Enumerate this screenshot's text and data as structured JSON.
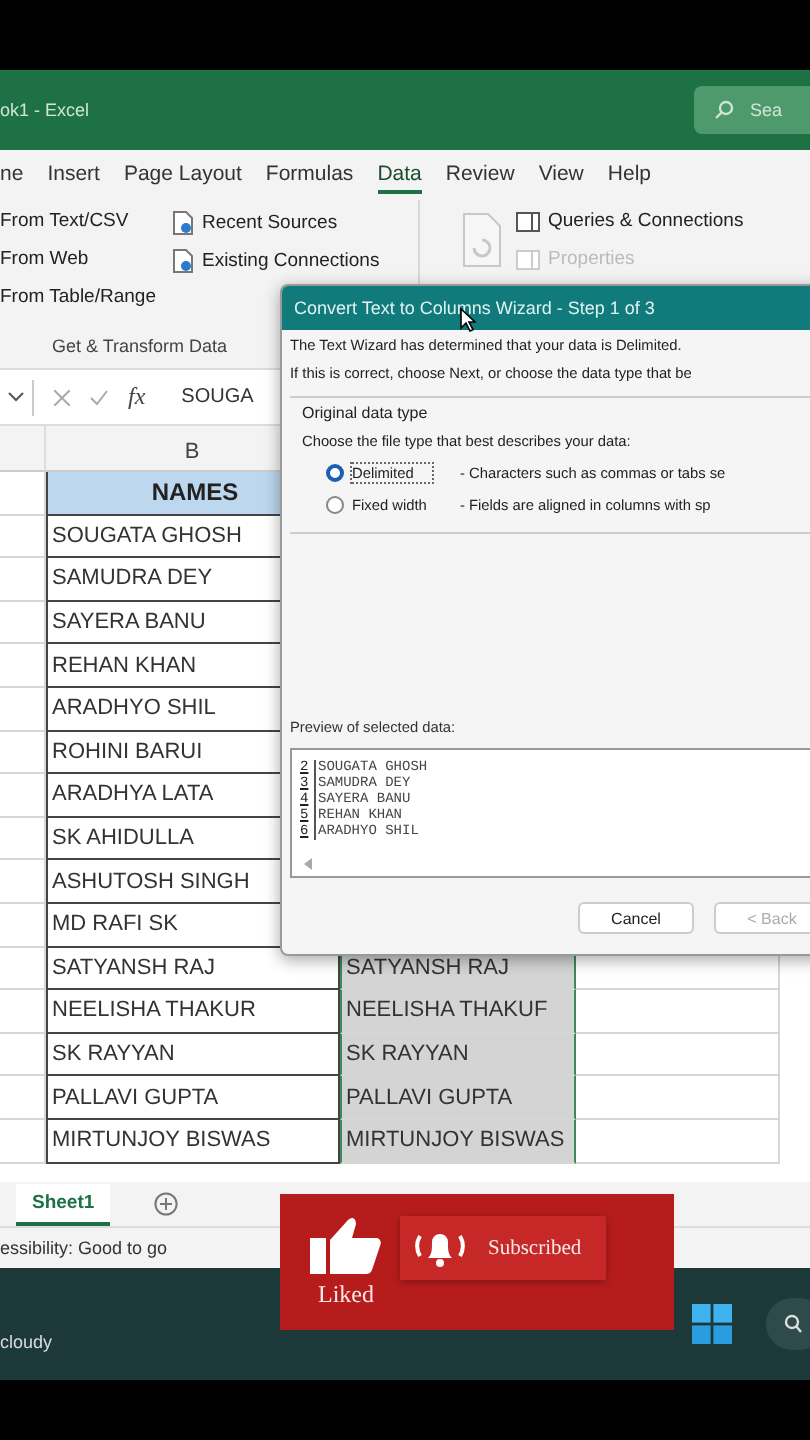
{
  "window": {
    "title": "ok1 - Excel",
    "search_placeholder": "Sea"
  },
  "ribbon_tabs": [
    {
      "label": "ne",
      "selected": false
    },
    {
      "label": "Insert",
      "selected": false
    },
    {
      "label": "Page Layout",
      "selected": false
    },
    {
      "label": "Formulas",
      "selected": false
    },
    {
      "label": "Data",
      "selected": true
    },
    {
      "label": "Review",
      "selected": false
    },
    {
      "label": "View",
      "selected": false
    },
    {
      "label": "Help",
      "selected": false
    }
  ],
  "ribbon": {
    "get_data": [
      "From Text/CSV",
      "From Web",
      "From Table/Range"
    ],
    "sources": [
      "Recent Sources",
      "Existing Connections"
    ],
    "group_label": "Get & Transform Data",
    "queries": [
      {
        "label": "Queries & Connections",
        "disabled": false
      },
      {
        "label": "Properties",
        "disabled": true
      }
    ]
  },
  "formula_bar": {
    "function_label": "fx",
    "value": "SOUGA"
  },
  "column_header": "B",
  "table": {
    "header": "NAMES",
    "rows": [
      {
        "column_b": "SOUGATA GHOSH"
      },
      {
        "column_b": "SAMUDRA DEY"
      },
      {
        "column_b": "SAYERA BANU"
      },
      {
        "column_b": "REHAN KHAN"
      },
      {
        "column_b": "ARADHYO SHIL"
      },
      {
        "column_b": "ROHINI BARUI"
      },
      {
        "column_b": "ARADHYA LATA"
      },
      {
        "column_b": "SK AHIDULLA"
      },
      {
        "column_b": "ASHUTOSH SINGH"
      },
      {
        "column_b": "MD RAFI SK"
      },
      {
        "column_b": "SATYANSH RAJ",
        "column_c": "SATYANSH RAJ"
      },
      {
        "column_b": "NEELISHA THAKUR",
        "column_c": "NEELISHA THAKUF"
      },
      {
        "column_b": "SK RAYYAN",
        "column_c": "SK RAYYAN"
      },
      {
        "column_b": "PALLAVI GUPTA",
        "column_c": "PALLAVI GUPTA"
      },
      {
        "column_b": "MIRTUNJOY BISWAS",
        "column_c": "MIRTUNJOY BISWAS"
      }
    ]
  },
  "dialog": {
    "title": "Convert Text to Columns Wizard - Step 1 of 3",
    "intro": "The Text Wizard has determined that your data is Delimited.",
    "hint": "If this is correct, choose Next, or choose the data type that be",
    "group_title": "Original data type",
    "prompt": "Choose the file type that best describes your data:",
    "options": [
      {
        "label": "Delimited",
        "description": "- Characters such as commas or tabs se",
        "selected": true
      },
      {
        "label": "Fixed width",
        "description": "- Fields are aligned in columns with sp",
        "selected": false
      }
    ],
    "preview_label": "Preview of selected data:",
    "preview": [
      {
        "number": "2",
        "text": "SOUGATA GHOSH"
      },
      {
        "number": "3",
        "text": "SAMUDRA DEY"
      },
      {
        "number": "4",
        "text": "SAYERA BANU"
      },
      {
        "number": "5",
        "text": "REHAN KHAN"
      },
      {
        "number": "6",
        "text": "ARADHYO SHIL"
      }
    ],
    "buttons": [
      "Cancel",
      "< Back"
    ]
  },
  "sheet_tabs": [
    {
      "label": "Sheet1",
      "selected": true
    }
  ],
  "status_bar": "essibility: Good to go",
  "taskbar": {
    "weather": "cloudy"
  },
  "overlay": {
    "liked": "Liked",
    "subscribed": "Subscribed"
  }
}
